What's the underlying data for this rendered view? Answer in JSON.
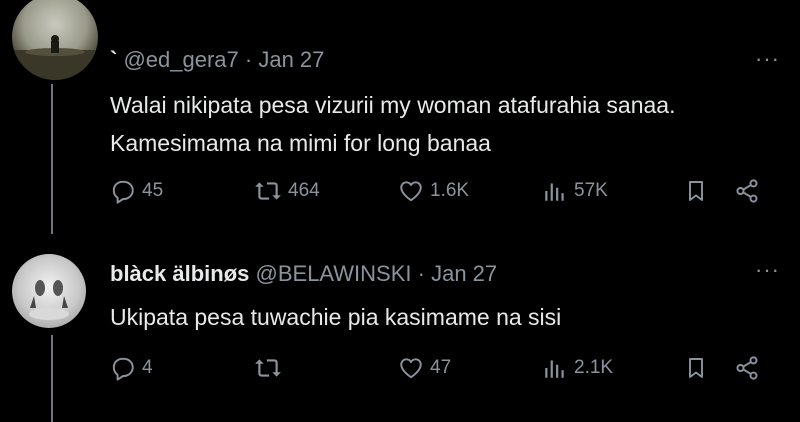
{
  "tweets": [
    {
      "name": "`",
      "handle": "@ed_gera7",
      "separator": "·",
      "date": "Jan 27",
      "text": "Walai nikipata pesa vizurii my woman atafurahia sanaa. Kamesimama na mimi for long banaa",
      "stats": {
        "replies": "45",
        "retweets": "464",
        "likes": "1.6K",
        "views": "57K"
      },
      "more": "···"
    },
    {
      "name": "blàck älbinøs",
      "handle": "@BELAWINSKI",
      "separator": "·",
      "date": "Jan 27",
      "text": "Ukipata pesa tuwachie pia kasimame na sisi",
      "stats": {
        "replies": "4",
        "retweets": "",
        "likes": "47",
        "views": "2.1K"
      },
      "more": "···"
    }
  ],
  "icons": {
    "reply": "reply-icon",
    "retweet": "retweet-icon",
    "like": "heart-icon",
    "views": "views-icon",
    "bookmark": "bookmark-icon",
    "share": "share-icon",
    "more": "more-icon"
  },
  "colors": {
    "background": "#000000",
    "text": "#e7e9ea",
    "secondary": "#8b949e",
    "thread_line": "#6e767d"
  }
}
